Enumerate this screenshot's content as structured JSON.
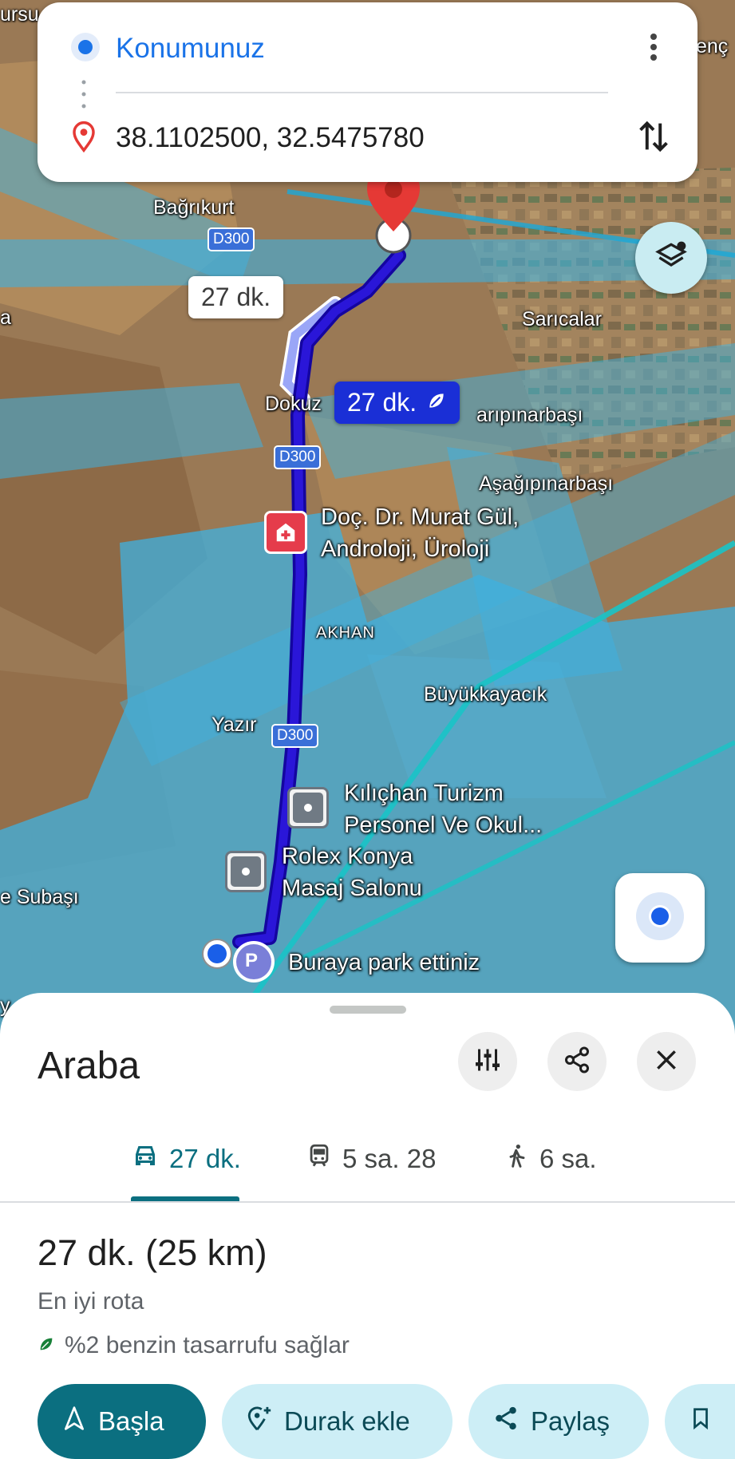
{
  "route_inputs": {
    "origin": "Konumunuz",
    "destination": "38.1102500, 32.5475780"
  },
  "map": {
    "place_labels": [
      "Bağrıkurt",
      "Sarıcalar",
      "Dokuz",
      "arıpınarbaşı",
      "Aşağıpınarbaşı",
      "AKHAN",
      "Büyükkayacık",
      "Yazır",
      "e Subaşı",
      "ursu",
      "enç",
      "a",
      "y"
    ],
    "road_shields": [
      "D300",
      "D300",
      "D300"
    ],
    "pois": {
      "hospital_line1": "Doç. Dr. Murat Gül,",
      "hospital_line2": "Androloji, Üroloji",
      "kilichan_line1": "Kılıçhan Turizm",
      "kilichan_line2": "Personel Ve Okul...",
      "rolex_line1": "Rolex Konya",
      "rolex_line2": "Masaj Salonu",
      "parking": "Buraya park ettiniz",
      "parking_letter": "P"
    },
    "alt_route_time": "27 dk.",
    "selected_route_time": "27 dk."
  },
  "sheet": {
    "title": "Araba",
    "modes": [
      {
        "icon": "car-icon",
        "label": "27 dk.",
        "active": true
      },
      {
        "icon": "train-icon",
        "label": "5 sa. 28",
        "active": false
      },
      {
        "icon": "walk-icon",
        "label": "6 sa.",
        "active": false
      }
    ],
    "summary": "27 dk. (25 km)",
    "route_note": "En iyi rota",
    "fuel_note": "%2 benzin tasarrufu sağlar",
    "actions": {
      "start": "Başla",
      "add_stop": "Durak ekle",
      "share": "Paylaş"
    }
  },
  "colors": {
    "route": "#2a16d8",
    "accent": "#0b6f80",
    "traffic_overlay": "#3fb1e0",
    "origin_blue": "#1a73e8",
    "destination_red": "#e53935"
  }
}
